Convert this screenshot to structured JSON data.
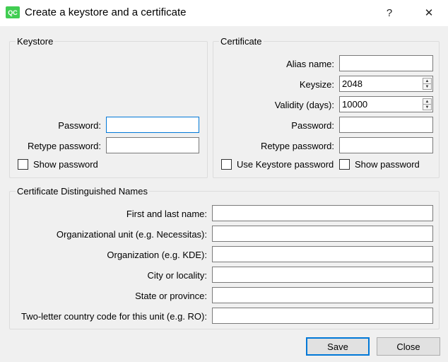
{
  "window": {
    "title": "Create a keystore and a certificate",
    "app_icon_text": "QC",
    "help_glyph": "?",
    "close_glyph": "✕"
  },
  "keystore": {
    "title": "Keystore",
    "password_label": "Password:",
    "password_value": "",
    "retype_label": "Retype password:",
    "retype_value": "",
    "show_password_label": "Show password",
    "show_password_checked": false
  },
  "certificate": {
    "title": "Certificate",
    "alias_label": "Alias name:",
    "alias_value": "",
    "keysize_label": "Keysize:",
    "keysize_value": "2048",
    "validity_label": "Validity (days):",
    "validity_value": "10000",
    "password_label": "Password:",
    "password_value": "",
    "retype_label": "Retype password:",
    "retype_value": "",
    "use_keystore_label": "Use Keystore password",
    "use_keystore_checked": false,
    "show_password_label": "Show password",
    "show_password_checked": false
  },
  "dn": {
    "title": "Certificate Distinguished Names",
    "fields": [
      {
        "label": "First and last name:",
        "value": ""
      },
      {
        "label": "Organizational unit (e.g. Necessitas):",
        "value": ""
      },
      {
        "label": "Organization (e.g. KDE):",
        "value": ""
      },
      {
        "label": "City or locality:",
        "value": ""
      },
      {
        "label": "State or province:",
        "value": ""
      },
      {
        "label": "Two-letter country code for this unit (e.g. RO):",
        "value": ""
      }
    ]
  },
  "buttons": {
    "save": "Save",
    "close": "Close"
  },
  "colors": {
    "focus_border": "#0078d7",
    "app_icon": "#41cd52"
  }
}
